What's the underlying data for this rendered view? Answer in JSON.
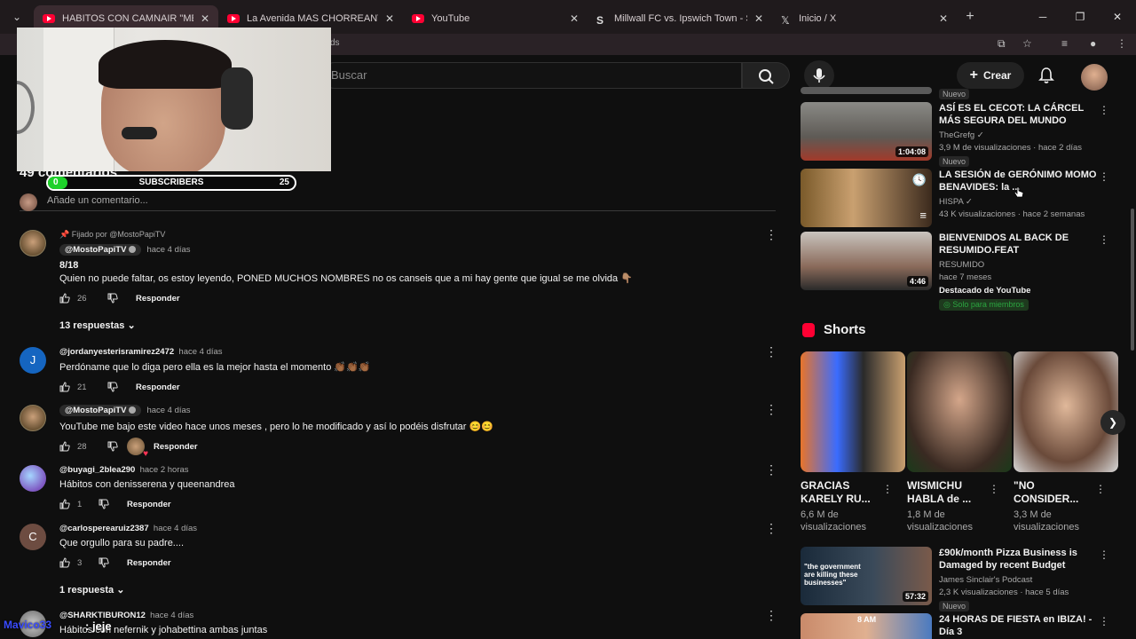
{
  "browser": {
    "tabs": [
      {
        "title": "HABITOS CON CAMNAIR \"ME E",
        "icon": "youtube-icon",
        "active": true
      },
      {
        "title": "La Avenida MAS CHORREANTE",
        "icon": "youtube-icon",
        "active": false
      },
      {
        "title": "YouTube",
        "icon": "youtube-icon",
        "active": false
      },
      {
        "title": "Millwall FC vs. Ipswich Town - S",
        "icon": "s-icon",
        "active": false
      },
      {
        "title": "Inicio / X",
        "icon": "x-icon",
        "active": false
      }
    ],
    "url_fragment": "ds"
  },
  "youtube": {
    "search_placeholder": "Buscar",
    "create_label": "Crear"
  },
  "stream_overlay": {
    "subscribers_label": "SUBSCRIBERS",
    "current": "0",
    "goal": "25",
    "progress": 0.0,
    "chat_user": "Mavico33",
    "chat_message": ": jeje"
  },
  "comments_section": {
    "count_label": "49 comentarios",
    "add_placeholder": "Añade un comentario...",
    "reply_label": "Responder",
    "comments": [
      {
        "pinned_label": "Fijado por @MostoPapiTV",
        "author": "@MostoPapiTV",
        "time": "hace 4 días",
        "line1": "8/18",
        "text": "Quien no puede faltar, os estoy leyendo, PONED MUCHOS NOMBRES no os canseis que a mi hay gente que igual se me olvida 👇🏽",
        "likes": "26",
        "replies": "13 respuestas"
      },
      {
        "author": "@jordanyesterisramirez2472",
        "time": "hace 4 días",
        "avatar_letter": "J",
        "text": "Perdóname que lo diga pero ella es la mejor hasta el momento 👏🏾👏🏾👏🏾",
        "likes": "21"
      },
      {
        "author": "@MostoPapiTV",
        "time": "hace 4 días",
        "text": "YouTube me bajo este video hace unos meses , pero lo he modificado y así lo podéis disfrutar 😊😊",
        "likes": "28"
      },
      {
        "author": "@buyagi_2blea290",
        "time": "hace 2 horas",
        "text": "Hábitos con denisserena y queenandrea",
        "likes": "1"
      },
      {
        "author": "@carlosperearuiz2387",
        "time": "hace 4 días",
        "avatar_letter": "C",
        "text": "Que orgullo para su padre....",
        "likes": "3",
        "replies": "1 respuesta"
      },
      {
        "author": "@SHARKTIBURON12",
        "time": "hace 4 días",
        "text": "Hábitos con nefernik y johabettina ambas juntas"
      }
    ]
  },
  "sidebar": {
    "top_badge": "Nuevo",
    "videos": [
      {
        "title": "ASÍ ES EL CECOT: LA CÁRCEL MÁS SEGURA DEL MUNDO",
        "channel": "TheGrefg",
        "stats": "3,9 M de visualizaciones · hace 2 días",
        "badge": "Nuevo",
        "duration": "1:04:08"
      },
      {
        "title": "LA SESIÓN de GERÓNIMO MOMO BENAVIDES: la ...",
        "channel": "HISPA",
        "stats": "43 K visualizaciones · hace 2 semanas"
      },
      {
        "title": "BIENVENIDOS AL BACK DE RESUMIDO.FEAT",
        "channel": "RESUMIDO",
        "stats": "hace 7 meses",
        "featured": "Destacado de YouTube",
        "members": "Solo para miembros",
        "duration": "4:46"
      },
      {
        "title": "£90k/month Pizza Business is Damaged by recent Budget",
        "channel": "James Sinclair's Podcast",
        "stats": "2,3 K visualizaciones · hace 5 días",
        "badge": "Nuevo",
        "duration": "57:32",
        "thumb_text": "\"the government are killing these businesses\""
      },
      {
        "title": "24 HORAS DE FIESTA en IBIZA! - Día 3",
        "thumb_text": "8 AM"
      }
    ],
    "shorts_header": "Shorts",
    "shorts": [
      {
        "title": "GRACIAS KARELY RU...",
        "views": "6,6 M de visualizaciones"
      },
      {
        "title": "WISMICHU HABLA de ...",
        "views": "1,8 M de visualizaciones"
      },
      {
        "title": "\"NO CONSIDER...",
        "views": "3,3 M de visualizaciones"
      }
    ]
  },
  "colors": {
    "youtube_red": "#ff0033",
    "background": "#0f0f0f",
    "sub_fill": "#1ed12a"
  }
}
